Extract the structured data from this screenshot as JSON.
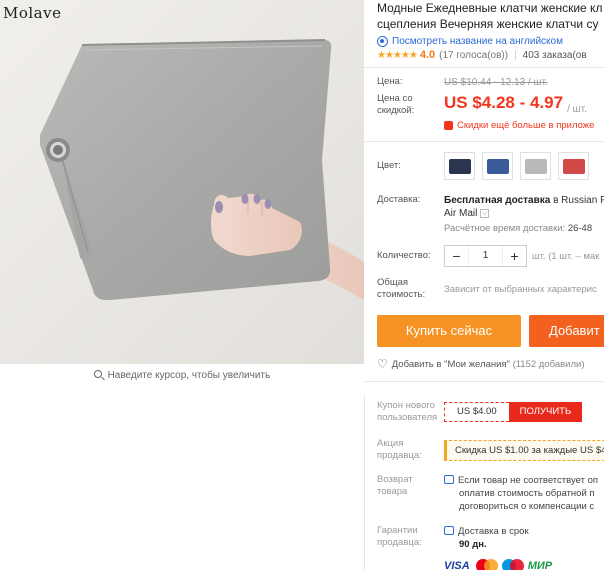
{
  "gallery": {
    "brand": "Molave",
    "zoom_hint": "Наведите курсор, чтобы увеличить"
  },
  "product": {
    "title_line1": "Модные Ежедневные клатчи женские кл",
    "title_line2": "сцепления Вечерняя женские клатчи су",
    "translate_link": "Посмотреть название на английском",
    "stars": "★★★★★",
    "rating": "4.0",
    "votes": "(17 голоса(ов))",
    "orders": "403 заказа(ов"
  },
  "price": {
    "label": "Цена:",
    "old": "US $10.44 - 12.13 / шт.",
    "discount_label": "Цена со скидкой:",
    "current": "US $4.28 - 4.97",
    "unit": "/ шт.",
    "promo": "Скидки ещё больше в приложе"
  },
  "color": {
    "label": "Цвет:",
    "swatches": [
      "#2a3550",
      "#3a5a9a",
      "#b9b9b7",
      "#d24a48"
    ]
  },
  "shipping": {
    "label": "Доставка:",
    "method_bold": "Бесплатная доставка",
    "method_rest": " в Russian F",
    "method_line2": "Air Mail",
    "chevron": "⌵",
    "time_label": "Расчётное время доставки:",
    "time_value": "26-48"
  },
  "quantity": {
    "label": "Количество:",
    "minus": "−",
    "value": "1",
    "plus": "+",
    "note": "шт. (1 шт. – мак"
  },
  "total": {
    "label": "Общая стоимость:",
    "value": "Зависит от выбранных характерис"
  },
  "actions": {
    "buy_now": "Купить сейчас",
    "add_to_cart": "Добавит",
    "wishlist": "Добавить в \"Мои желания\"",
    "wishlist_count": "(1152 добавили)"
  },
  "coupon": {
    "label": "Купон нового пользователя",
    "value": "US $4.00",
    "button": "ПОЛУЧИТЬ"
  },
  "seller_promo": {
    "label": "Акция продавца:",
    "text": "Скидка US $1.00 за каждые US $4"
  },
  "returns": {
    "label": "Возврат товара",
    "line1": "Если товар не соответствует оп",
    "line2": "оплатив стоимость обратной п",
    "line3": "договориться о компенсации с"
  },
  "guarantee": {
    "label": "Гарантии продавца:",
    "line1": "Доставка в срок",
    "line2": "90 дн."
  },
  "payment": {
    "visa": "VISA",
    "mir": "МИР"
  }
}
